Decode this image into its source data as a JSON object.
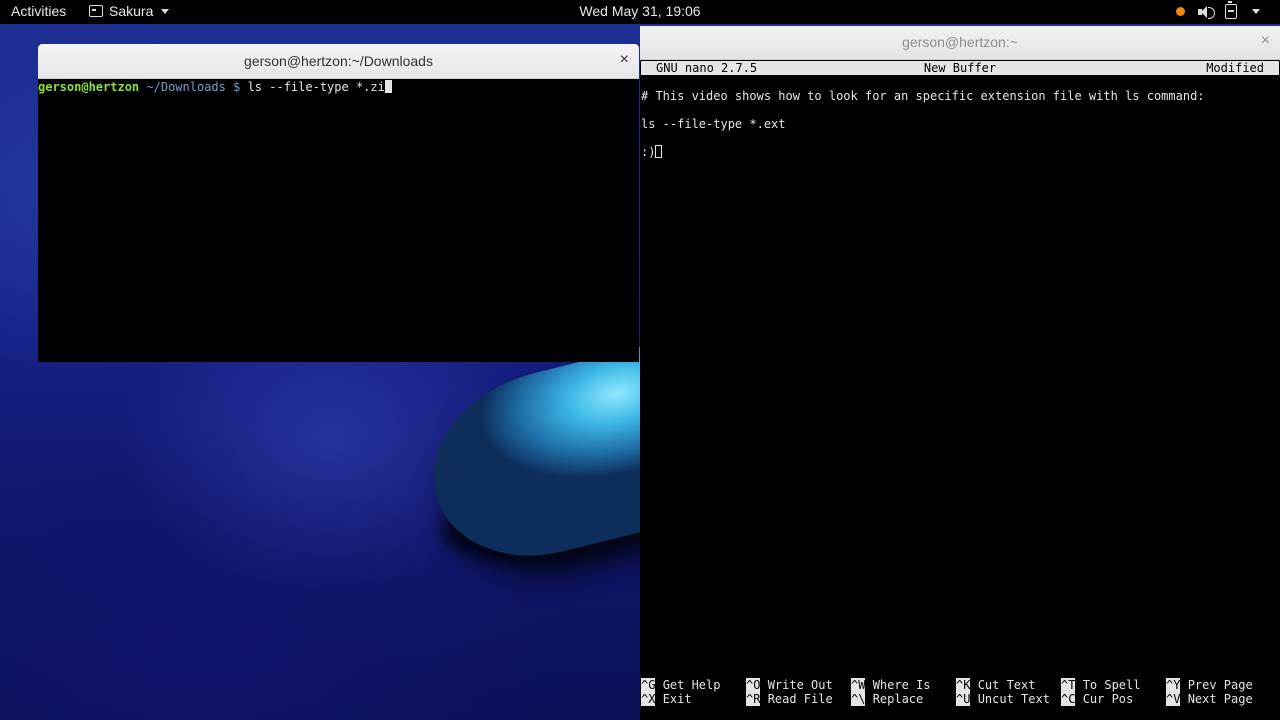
{
  "topbar": {
    "activities": "Activities",
    "app_name": "Sakura",
    "clock": "Wed May 31, 19:06",
    "tray_icons": [
      "notification-dot-icon",
      "volume-icon",
      "battery-icon"
    ]
  },
  "left_window": {
    "title": "gerson@hertzon:~/Downloads",
    "close": "×",
    "prompt_user": "gerson@hertzon",
    "prompt_dir": "~/Downloads",
    "prompt_sign": "$",
    "command": "ls --file-type *.zi"
  },
  "right_window": {
    "title": "gerson@hertzon:~",
    "close": "×",
    "nano": {
      "version": "GNU nano 2.7.5",
      "filename": "New Buffer",
      "status": "Modified",
      "lines": [
        "# This video shows how to look for an specific extension file with ls command:",
        "",
        "ls --file-type *.ext",
        "",
        ":)"
      ],
      "shortcuts": [
        {
          "key": "^G",
          "label": "Get Help"
        },
        {
          "key": "^O",
          "label": "Write Out"
        },
        {
          "key": "^W",
          "label": "Where Is"
        },
        {
          "key": "^K",
          "label": "Cut Text"
        },
        {
          "key": "^T",
          "label": "To Spell"
        },
        {
          "key": "^Y",
          "label": "Prev Page"
        },
        {
          "key": "^X",
          "label": "Exit"
        },
        {
          "key": "^R",
          "label": "Read File"
        },
        {
          "key": "^\\",
          "label": "Replace"
        },
        {
          "key": "^U",
          "label": "Uncut Text"
        },
        {
          "key": "^C",
          "label": "Cur Pos"
        },
        {
          "key": "^V",
          "label": "Next Page"
        }
      ]
    }
  },
  "colors": {
    "prompt_user": "#8ae234",
    "prompt_dir": "#729fcf",
    "tray_dot": "#f08a00"
  }
}
